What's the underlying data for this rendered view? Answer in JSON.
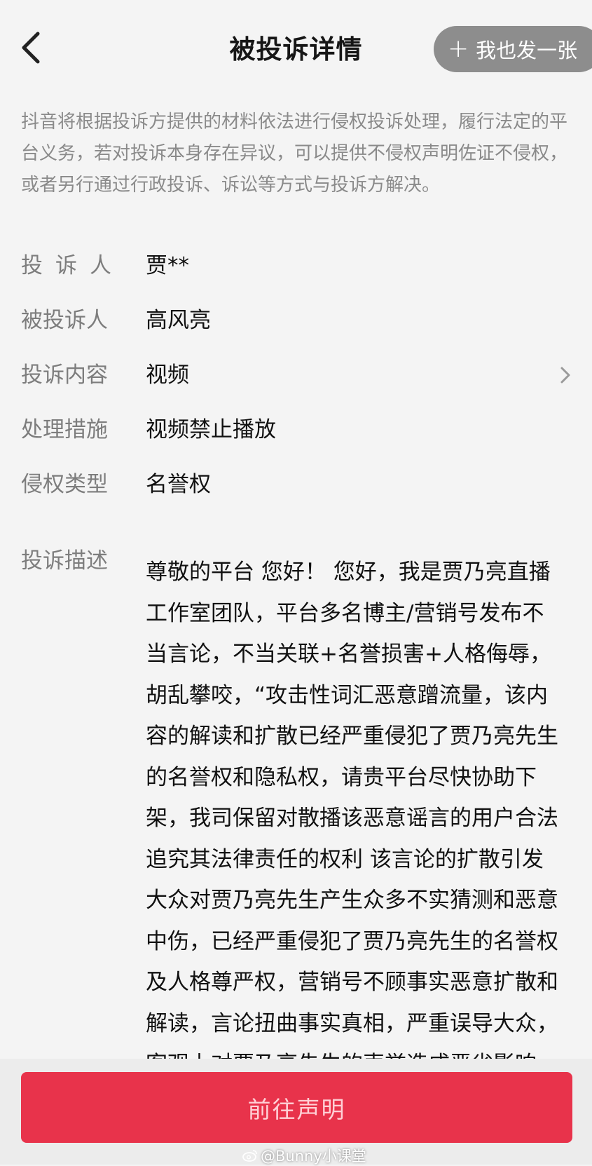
{
  "header": {
    "title": "被投诉详情",
    "back_icon": "chevron-left-icon",
    "post_button": {
      "icon": "+",
      "label": "我也发一张"
    }
  },
  "notice": "抖音将根据投诉方提供的材料依法进行侵权投诉处理，履行法定的平台义务，若对投诉本身存在异议，可以提供不侵权声明佐证不侵权，或者另行通过行政投诉、诉讼等方式与投诉方解决。",
  "details": {
    "complainant": {
      "label": "投诉人",
      "value": "贾**"
    },
    "respondent": {
      "label": "被投诉人",
      "value": "高风亮"
    },
    "content": {
      "label": "投诉内容",
      "value": "视频"
    },
    "measure": {
      "label": "处理措施",
      "value": "视频禁止播放"
    },
    "infringement_type": {
      "label": "侵权类型",
      "value": "名誉权"
    },
    "description": {
      "label": "投诉描述",
      "value": "尊敬的平台 您好！ 您好，我是贾乃亮直播工作室团队，平台多名博主/营销号发布不当言论，不当关联+名誉损害+人格侮辱，胡乱攀咬，“攻击性词汇恶意蹭流量，该内容的解读和扩散已经严重侵犯了贾乃亮先生的名誉权和隐私权，请贵平台尽快协助下架，我司保留对散播该恶意谣言的用户合法追究其法律责任的权利 该言论的扩散引发大众对贾乃亮先生产生众多不实猜测和恶意中伤，已经严重侵犯了贾乃亮先生的名誉权及人格尊严权，营销号不顾事实恶意扩散和解读，言论扭曲事实真相，严重误导大众，客观上对贾乃亮先生的声誉造成恶劣影响。 文章持续引发广大用户的关注讨论和不实猜测不仅严重损害贾乃亮先生"
    }
  },
  "action_button": {
    "label": "前往声明",
    "color": "#e8334b"
  },
  "watermark": "@Bunny小课堂"
}
